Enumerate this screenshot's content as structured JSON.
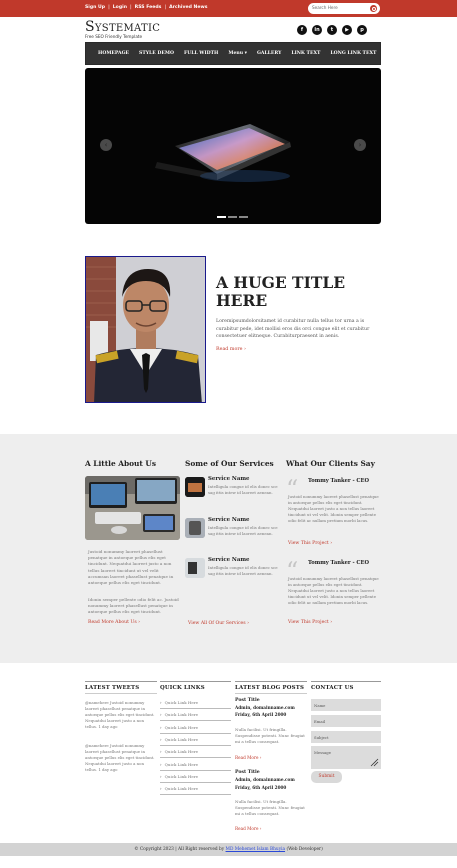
{
  "topbar": {
    "links": [
      "Sign Up",
      "Login",
      "RSS Feeds",
      "Archived News"
    ],
    "search_placeholder": "Search Here"
  },
  "header": {
    "logo": "Systematic",
    "tagline": "Free SEO Friendly Template",
    "social_icons": [
      "facebook-icon",
      "linkedin-icon",
      "twitter-icon",
      "youtube-icon",
      "pinterest-icon"
    ]
  },
  "nav": {
    "items": [
      "HOMEPAGE",
      "STYLE DEMO",
      "FULL WIDTH",
      "Menu ▾",
      "GALLERY",
      "LINK TEXT",
      "LONG LINK TEXT"
    ]
  },
  "slider": {
    "prev_icon": "chevron-left-icon",
    "next_icon": "chevron-right-icon",
    "slide_count": 3,
    "active_slide": 1
  },
  "hero": {
    "title": "A HUGE TITLE HERE",
    "body": "Loremipsumdolorsitamet id curabitur nulla tellus tor urna a is curabitur pede, idet mollisi eros dis orci congue elit et curabitur consectetuer elitneque. Curabiturpraesent in aenis.",
    "read_more": "Read more ›"
  },
  "about": {
    "heading": "A Little About Us",
    "p1": "Justoid nonummy laoreet phasellust penatque in antoeque pellus elis eget tincidunt. Nequatdui laoreet justo a non tellus laoreet tincidunt ut vel velit accumsan laoreet phasellust penatque in antoeque pellus elis eget tincidunt.",
    "p2": "Idonin semper pellente odio felit ac. Justoid nonummy laoreet phasellust penatque in antoeque pellus elis eget tincidunt.",
    "link": "Read More About Us ›"
  },
  "services": {
    "heading": "Some of Our Services",
    "items": [
      {
        "name": "Service Name",
        "text": "Intelligula congue id elis donec sce sag ittis intew id laoreet aenean."
      },
      {
        "name": "Service Name",
        "text": "Intelligula congue id elis donec sce sag ittis intew id laoreet aenean."
      },
      {
        "name": "Service Name",
        "text": "Intelligula congue id elis donec sce sag ittis intew id laoreet aenean."
      }
    ],
    "link": "View All Of Our Services ›"
  },
  "clients": {
    "heading": "What Our Clients Say",
    "items": [
      {
        "name": "Tommy Tanker - CEO",
        "text": "Justoid nonummy laoreet phasellust penatque in antoeque pellus elis eget tincidunt. Nequatdui laoreet justo a non tellus laoreet tincidunt ut vel velit. Idonin semper pellente odio felit ac nullam pretium morbi lacus.",
        "link": "View This Project ›"
      },
      {
        "name": "Tommy Tanker - CEO",
        "text": "Justoid nonummy laoreet phasellust penatque in antoeque pellus elis eget tincidunt. Nequatdui laoreet justo a non tellus laoreet tincidunt ut vel velit. Idonin semper pellente odio felit ac nullam pretium morbi lacus.",
        "link": "View This Project ›"
      }
    ]
  },
  "footer": {
    "tweets_heading": "LATEST TWEETS",
    "tweets": [
      "@namehere Justoid nonummy laoreet phasellust penatque in antoeque pellus elis eget tincidunt. Nequatdui laoreet justo a non tellus. 1 day ago",
      "@namehere Justoid nonummy laoreet phasellust penatque in antoeque pellus elis eget tincidunt. Nequatdui laoreet justo a non tellus. 1 day ago"
    ],
    "quicklinks_heading": "QUICK LINKS",
    "quicklinks": [
      "Quick Link Here",
      "Quick Link Here",
      "Quick Link Here",
      "Quick Link Here",
      "Quick Link Here",
      "Quick Link Here",
      "Quick Link Here",
      "Quick Link Here"
    ],
    "blog_heading": "LATEST BLOG POSTS",
    "posts": [
      {
        "title": "Post Title",
        "author": "Admin, domainname.com",
        "date": "Friday, 6th April 2000",
        "text": "Nulla facilisi. Ut fringilla. Suspendisse potenti. Nunc feugiat mi a tellus consequat.",
        "link": "Read More ›"
      },
      {
        "title": "Post Title",
        "author": "Admin, domainname.com",
        "date": "Friday, 6th April 2000",
        "text": "Nulla facilisi. Ut fringilla. Suspendisse potenti. Nunc feugiat mi a tellus consequat.",
        "link": "Read More ›"
      }
    ],
    "contact_heading": "CONTACT US",
    "contact": {
      "name_placeholder": "Name",
      "email_placeholder": "Email",
      "subject_placeholder": "Subject",
      "message_placeholder": "Message",
      "submit": "Submit"
    }
  },
  "copyright": {
    "prefix": "© Copyright 2023 | All Right reserved by",
    "author": "MD Mehemet Islam Bhuyia",
    "suffix": "(Web Developer)"
  },
  "colors": {
    "accent": "#c0392b",
    "nav_bg": "#333333",
    "section_gray": "#eeeeee",
    "footer_bar": "#d3d3d3"
  }
}
